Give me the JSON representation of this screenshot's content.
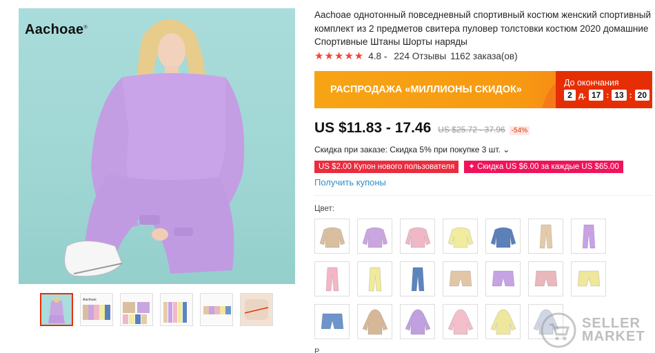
{
  "brand": {
    "logo_text": "Aachoae"
  },
  "product": {
    "title": "Aachoae однотонный повседневный спортивный костюм женский спортивный комплект из 2 предметов свитера пуловер толстовки костюм 2020 домашние Спортивные Штаны Шорты наряды",
    "rating_stars": "★★★★★",
    "rating": "4.8",
    "reviews": "224 Отзывы",
    "orders": "1162 заказа(ов)"
  },
  "sale": {
    "banner_text": "РАСПРОДАЖА «МИЛЛИОНЫ СКИДОК»",
    "countdown_label": "До окончания",
    "days": "2",
    "days_unit": "д.",
    "hours": "17",
    "minutes": "13",
    "seconds": "20"
  },
  "price": {
    "current": "US $11.83 - 17.46",
    "original": "US $25.72 - 37.96",
    "discount": "-54%"
  },
  "bulk_discount": "Скидка при заказе: Скидка 5% при покупке 3 шт. ⌄",
  "coupons": [
    "US $2.00 Купон нового пользователя",
    "✦ Скидка US $6.00 за каждые US $65.00"
  ],
  "get_coupons": "Получить купоны",
  "color_label": "Цвет:",
  "colors": {
    "swatches": [
      {
        "kind": "sweater",
        "color": "#d9bfa0"
      },
      {
        "kind": "sweater",
        "color": "#c9a6e0"
      },
      {
        "kind": "sweater",
        "color": "#f0b8c6"
      },
      {
        "kind": "sweater",
        "color": "#f1ec9e"
      },
      {
        "kind": "sweater",
        "color": "#5c80b8"
      },
      {
        "kind": "pants",
        "color": "#e4cba8"
      },
      {
        "kind": "pants",
        "color": "#c8a1e6"
      },
      {
        "kind": "pants",
        "color": "#f4b6c5"
      },
      {
        "kind": "pants",
        "color": "#f0ea9c"
      },
      {
        "kind": "pants",
        "color": "#5c84bd"
      },
      {
        "kind": "shorts",
        "color": "#e2c6a6"
      },
      {
        "kind": "shorts",
        "color": "#c6a3e3"
      },
      {
        "kind": "shorts",
        "color": "#eab7bd"
      },
      {
        "kind": "shorts",
        "color": "#eee79c"
      },
      {
        "kind": "shorts",
        "color": "#6e94cc"
      },
      {
        "kind": "hoodie",
        "color": "#d6b899"
      },
      {
        "kind": "hoodie",
        "color": "#c1a0df"
      },
      {
        "kind": "hoodie",
        "color": "#f2bfcb"
      },
      {
        "kind": "hoodie",
        "color": "#efe79d"
      },
      {
        "kind": "hoodie",
        "color": "#cfd6e4"
      }
    ]
  },
  "bottom_label": "Р",
  "watermark": {
    "line1": "SELLER",
    "line2": "MARKET"
  },
  "thumbnails": [
    {
      "color": "#c9a6e0"
    },
    {
      "color": "#d8bfa0"
    },
    {
      "color": "#c6b3a0"
    },
    {
      "color": "#d6c8b0"
    },
    {
      "color": "#c9b9a4"
    },
    {
      "color": "#f0d4c0"
    }
  ]
}
